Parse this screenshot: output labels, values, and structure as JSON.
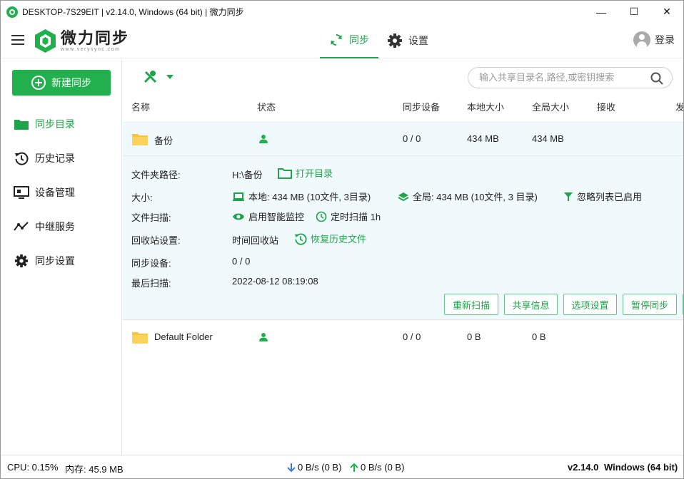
{
  "window": {
    "title": "DESKTOP-7S29EIT | v2.14.0, Windows (64 bit) | 微力同步",
    "controls": {
      "minimize": "—",
      "maximize": "☐",
      "close": "✕"
    }
  },
  "header": {
    "logo_name": "微力同步",
    "logo_url": "www.verysync.com",
    "tabs": [
      {
        "label": "同步",
        "icon": "sync-icon",
        "active": true
      },
      {
        "label": "设置",
        "icon": "gear-icon",
        "active": false
      }
    ],
    "login_label": "登录"
  },
  "sidebar": {
    "new_sync_label": "新建同步",
    "items": [
      {
        "label": "同步目录",
        "icon": "folder-icon",
        "active": true
      },
      {
        "label": "历史记录",
        "icon": "history-icon"
      },
      {
        "label": "设备管理",
        "icon": "monitor-icon"
      },
      {
        "label": "中继服务",
        "icon": "relay-icon"
      },
      {
        "label": "同步设置",
        "icon": "gear-icon"
      }
    ]
  },
  "main": {
    "search_placeholder": "输入共享目录名,路径,或密钥搜索",
    "columns": [
      "名称",
      "状态",
      "同步设备",
      "本地大小",
      "全局大小",
      "接收",
      "发"
    ],
    "folders": [
      {
        "name": "备份",
        "devices": "0 / 0",
        "local": "434 MB",
        "global": "434 MB",
        "selected": true
      },
      {
        "name": "Default Folder",
        "devices": "0 / 0",
        "local": "0 B",
        "global": "0 B",
        "selected": false
      }
    ],
    "detail": {
      "path_label": "文件夹路径:",
      "path_value": "H:\\备份",
      "open_dir": "打开目录",
      "size_label": "大小:",
      "local_size": "本地: 434 MB (10文件, 3目录)",
      "global_size": "全局: 434 MB (10文件, 3 目录)",
      "ignore": "忽略列表已启用",
      "scan_label": "文件扫描:",
      "smart_monitor": "启用智能监控",
      "timed_scan": "定时扫描 1h",
      "recycle_label": "回收站设置:",
      "recycle_value": "时间回收站",
      "restore": "恢复历史文件",
      "devices_label": "同步设备:",
      "devices_value": "0 / 0",
      "last_scan_label": "最后扫描:",
      "last_scan_value": "2022-08-12 08:19:08",
      "buttons": [
        "重新扫描",
        "共享信息",
        "选项设置",
        "暂停同步"
      ]
    }
  },
  "statusbar": {
    "cpu": "CPU: 0.15%",
    "mem": "内存: 45.9 MB",
    "down": "0 B/s (0 B)",
    "up": "0 B/s (0 B)",
    "version": "v2.14.0",
    "os": "Windows (64 bit)"
  },
  "colors": {
    "accent": "#22b04f",
    "folder": "#f7c53f",
    "selected_bg": "#f0f9fb",
    "down_arrow": "#3a7be0"
  }
}
